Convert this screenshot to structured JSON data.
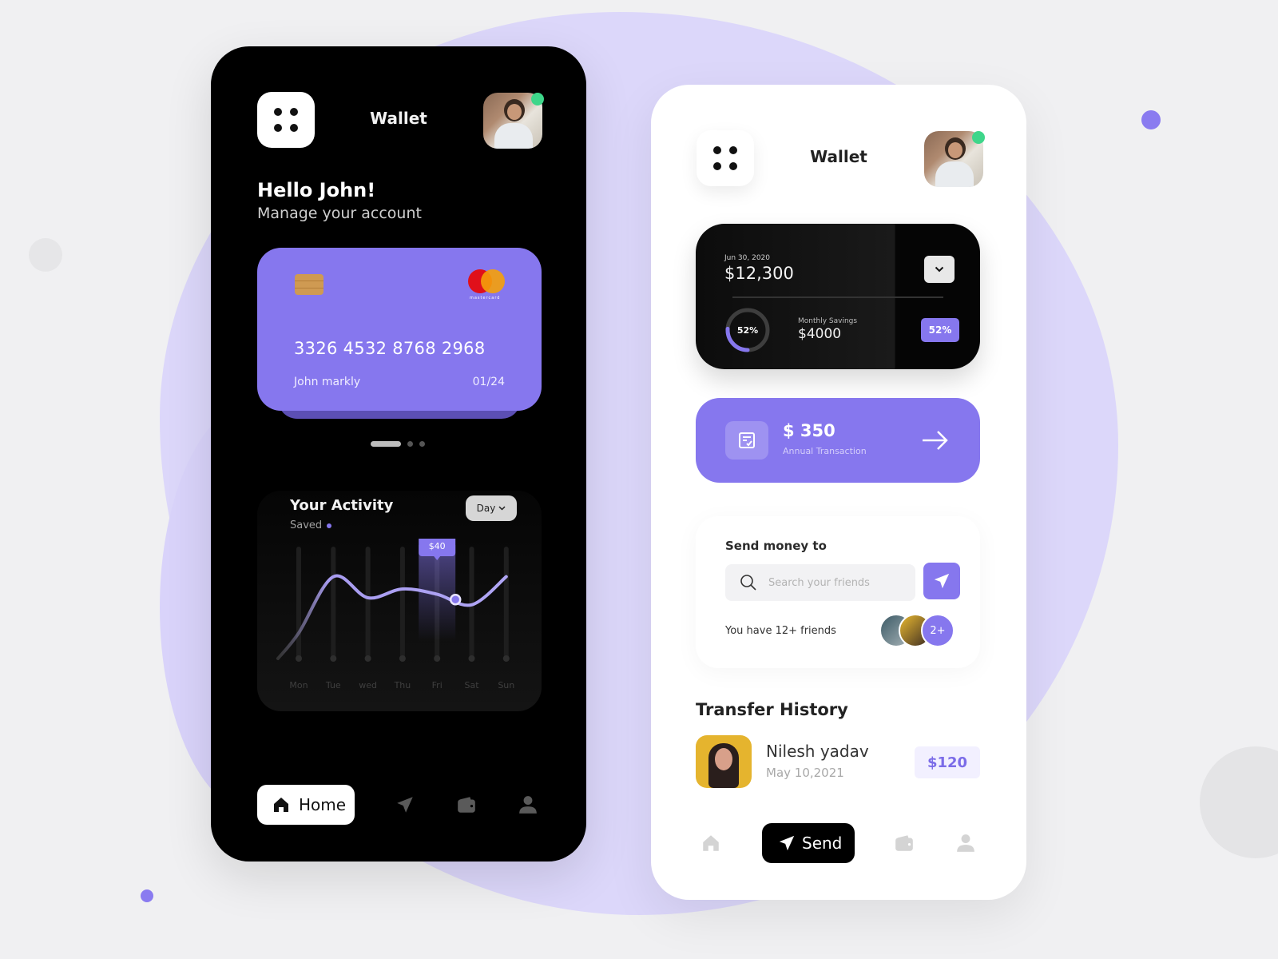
{
  "colors": {
    "accent": "#8677ee",
    "online": "#3ed68a",
    "dark_bg": "#000000",
    "light_bg": "#ffffff"
  },
  "dark_phone": {
    "header": {
      "title": "Wallet",
      "menu_icon": "grid-dots-icon",
      "avatar_status": "online"
    },
    "greeting": {
      "title": "Hello John!",
      "subtitle": "Manage your account"
    },
    "card": {
      "number": "3326 4532 8768 2968",
      "holder": "John markly",
      "expiry": "01/24",
      "brand": "mastercard",
      "brand_label": "mastercard"
    },
    "carousel": {
      "pages": 3,
      "active": 1
    },
    "activity": {
      "title": "Your Activity",
      "subtitle": "Saved",
      "period_button": "Day",
      "tooltip": "$40",
      "selected_day": "Fri"
    },
    "nav": {
      "items": [
        {
          "label": "Home",
          "icon": "home-icon",
          "active": true
        },
        {
          "label": "",
          "icon": "send-icon",
          "active": false
        },
        {
          "label": "",
          "icon": "wallet-icon",
          "active": false
        },
        {
          "label": "",
          "icon": "user-icon",
          "active": false
        }
      ]
    }
  },
  "chart_data": {
    "type": "line",
    "title": "Your Activity",
    "categories": [
      "Mon",
      "Tue",
      "wed",
      "Thu",
      "Fri",
      "Sat",
      "Sun"
    ],
    "series": [
      {
        "name": "Saved",
        "values": [
          10,
          42,
          30,
          35,
          32,
          26,
          42
        ]
      }
    ],
    "highlight": {
      "category": "Fri",
      "label": "$40"
    },
    "xlabel": "",
    "ylabel": "",
    "ylim": [
      0,
      50
    ],
    "grid": false,
    "legend": "top-left"
  },
  "light_phone": {
    "header": {
      "title": "Wallet",
      "menu_icon": "grid-dots-icon",
      "avatar_status": "online"
    },
    "balance": {
      "date": "Jun 30, 2020",
      "amount": "$12,300",
      "savings_label": "Monthly Savings",
      "savings_value": "$4000",
      "progress_percent": 52,
      "progress_text": "52%",
      "badge_text": "52%"
    },
    "annual": {
      "amount": "$ 350",
      "label": "Annual Transaction"
    },
    "send_money": {
      "title": "Send money to",
      "search_placeholder": "Search your friends",
      "search_value": "",
      "friends_text": "You have 12+ friends",
      "more_count": "2+"
    },
    "transfer_history": {
      "title": "Transfer History",
      "items": [
        {
          "name": "Nilesh yadav",
          "date": "May 10,2021",
          "amount": "$120"
        }
      ]
    },
    "nav": {
      "items": [
        {
          "label": "",
          "icon": "home-icon",
          "active": false
        },
        {
          "label": "Send",
          "icon": "send-icon",
          "active": true
        },
        {
          "label": "",
          "icon": "wallet-icon",
          "active": false
        },
        {
          "label": "",
          "icon": "user-icon",
          "active": false
        }
      ]
    }
  }
}
